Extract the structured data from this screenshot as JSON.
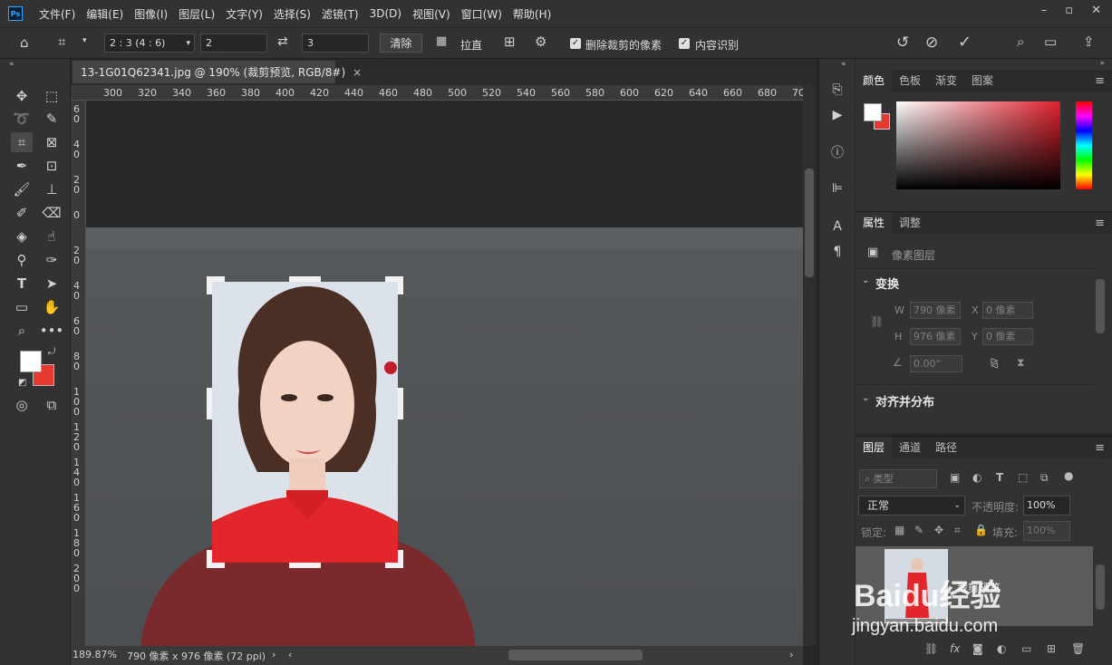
{
  "menubar": {
    "logo": "Ps",
    "items": [
      "文件(F)",
      "编辑(E)",
      "图像(I)",
      "图层(L)",
      "文字(Y)",
      "选择(S)",
      "滤镜(T)",
      "3D(D)",
      "视图(V)",
      "窗口(W)",
      "帮助(H)"
    ],
    "window_buttons": [
      "minimize-icon",
      "restore-icon",
      "close-icon"
    ]
  },
  "options": {
    "ratio_preset": "2 : 3 (4 : 6)",
    "width_value": "2",
    "height_value": "3",
    "clear_label": "清除",
    "straighten_label": "拉直",
    "delete_cropped_label": "删除裁剪的像素",
    "delete_cropped_checked": true,
    "content_aware_label": "内容识别",
    "content_aware_checked": true
  },
  "document": {
    "tab_title": "13-1G01Q62341.jpg @ 190% (裁剪预览, RGB/8#)",
    "tab_close": "×",
    "ruler_h": [
      "300",
      "320",
      "340",
      "360",
      "380",
      "400",
      "420",
      "440",
      "460",
      "480",
      "500",
      "520",
      "540",
      "560",
      "580",
      "600",
      "620",
      "640",
      "660",
      "680",
      "70"
    ],
    "ruler_v": [
      "6 0",
      "4 0",
      "2 0",
      "0",
      "2 0",
      "4 0",
      "6 0",
      "8 0",
      "1 0 0",
      "1 2 0",
      "1 4 0",
      "1 6 0",
      "1 8 0",
      "2 0 0"
    ]
  },
  "status": {
    "zoom": "189.87%",
    "dimensions": "790 像素 x 976 像素 (72 ppi)"
  },
  "color_panel": {
    "tabs": [
      "颜色",
      "色板",
      "渐变",
      "图案"
    ],
    "foreground": "#ffffff",
    "background": "#e8382f"
  },
  "properties_panel": {
    "tabs": [
      "属性",
      "调整"
    ],
    "layer_type": "像素图层",
    "transform_title": "变换",
    "w_label": "W",
    "w_value": "790 像素",
    "x_label": "X",
    "x_value": "0 像素",
    "h_label": "H",
    "h_value": "976 像素",
    "y_label": "Y",
    "y_value": "0 像素",
    "angle_value": "0.00°",
    "align_title": "对齐并分布"
  },
  "layers_panel": {
    "tabs": [
      "图层",
      "通道",
      "路径"
    ],
    "filter_placeholder": "类型",
    "blend_mode": "正常",
    "opacity_label": "不透明度:",
    "opacity_value": "100%",
    "lock_label": "锁定:",
    "fill_label": "填充:",
    "fill_value": "100%",
    "layer_name": "裁剪预览"
  },
  "watermark": {
    "text_top": "Baidu经验",
    "text_bottom": "jingyan.baidu.com"
  }
}
